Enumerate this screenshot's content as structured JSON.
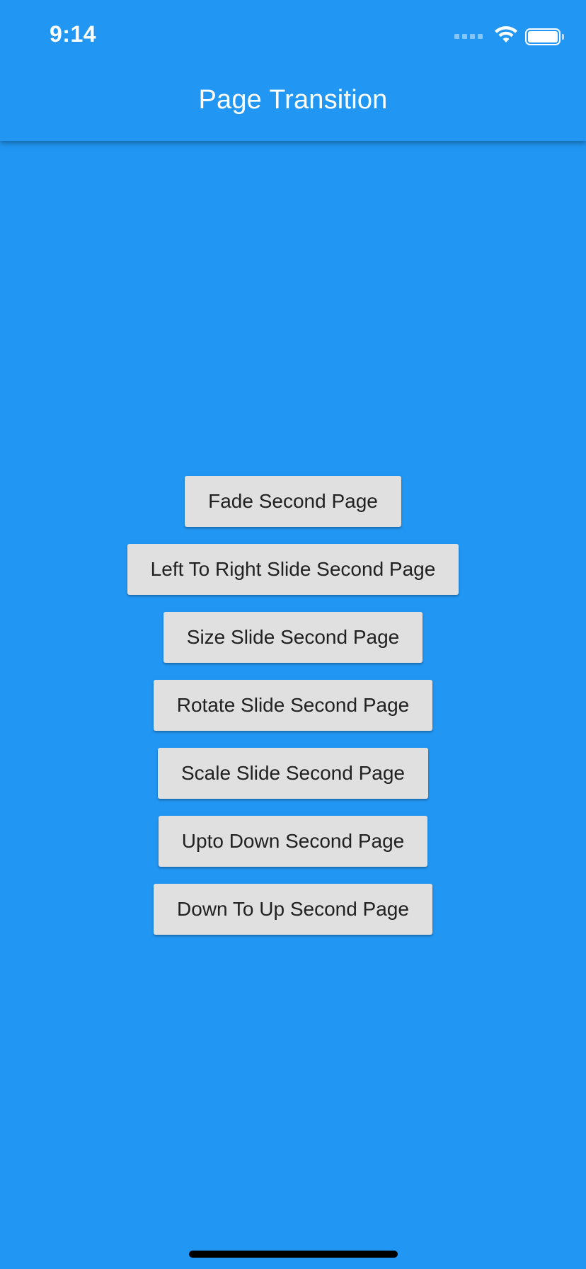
{
  "status_bar": {
    "time": "9:14",
    "wifi_icon": "wifi-icon",
    "battery_icon": "battery-icon",
    "signal_icon": "cellular-signal-icon"
  },
  "app_bar": {
    "title": "Page Transition"
  },
  "buttons": [
    {
      "label": "Fade Second Page"
    },
    {
      "label": "Left To Right Slide Second Page"
    },
    {
      "label": "Size Slide Second Page"
    },
    {
      "label": "Rotate Slide Second Page"
    },
    {
      "label": "Scale Slide Second Page"
    },
    {
      "label": "Upto Down Second Page"
    },
    {
      "label": "Down To Up Second Page"
    }
  ],
  "colors": {
    "primary": "#2196F3",
    "button_bg": "#E0E0E0",
    "button_text": "#212121",
    "title_text": "#FFFFFF"
  }
}
